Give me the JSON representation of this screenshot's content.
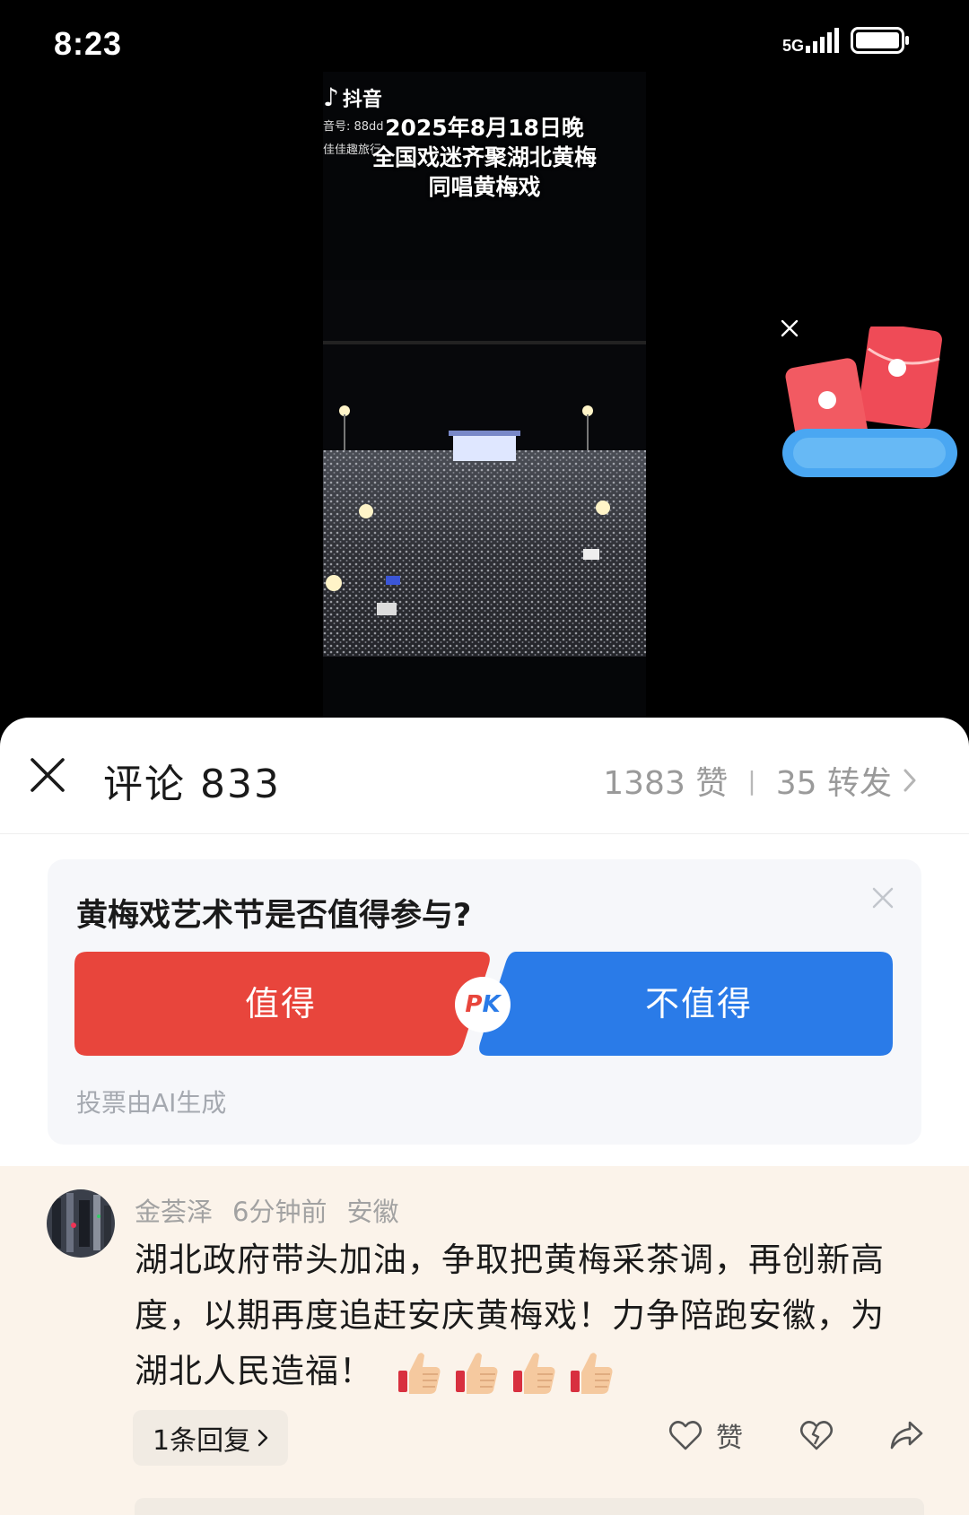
{
  "status_bar": {
    "time": "8:23",
    "network": "5G",
    "signal_icon": "signal-icon",
    "battery_icon": "battery-icon"
  },
  "video": {
    "platform_logo": "抖音",
    "watermark_id": "音号: 88dd",
    "watermark_author": "佳佳趣旅行",
    "caption_lines": [
      "2025年8月18日晚",
      "全国戏迷齐聚湖北黄梅",
      "同唱黄梅戏"
    ]
  },
  "floating_widget": {
    "icon": "red-packet-icon",
    "close_icon": "close-icon"
  },
  "comments_sheet": {
    "title": "评论 833",
    "likes": "1383 赞",
    "separator": "|",
    "shares": "35 转发",
    "close_icon": "close-icon"
  },
  "poll": {
    "question": "黄梅戏艺术节是否值得参与?",
    "option_yes": "值得",
    "option_no": "不值得",
    "pk_p": "P",
    "pk_k": "K",
    "note": "投票由AI生成",
    "colors": {
      "yes": "#e8453c",
      "no": "#2a7be8"
    }
  },
  "comment": {
    "author": "金荟泽",
    "time_ago": "6分钟前",
    "location": "安徽",
    "text": "湖北政府带头加油，争取把黄梅采茶调，再创新高度，以期再度追赶安庆黄梅戏！力争陪跑安徽，为湖北人民造福！",
    "emoji_icons": [
      "thumbs-up-icon",
      "thumbs-up-icon",
      "thumbs-up-icon",
      "thumbs-up-icon"
    ],
    "replies_label": "1条回复",
    "like_label": "赞"
  }
}
